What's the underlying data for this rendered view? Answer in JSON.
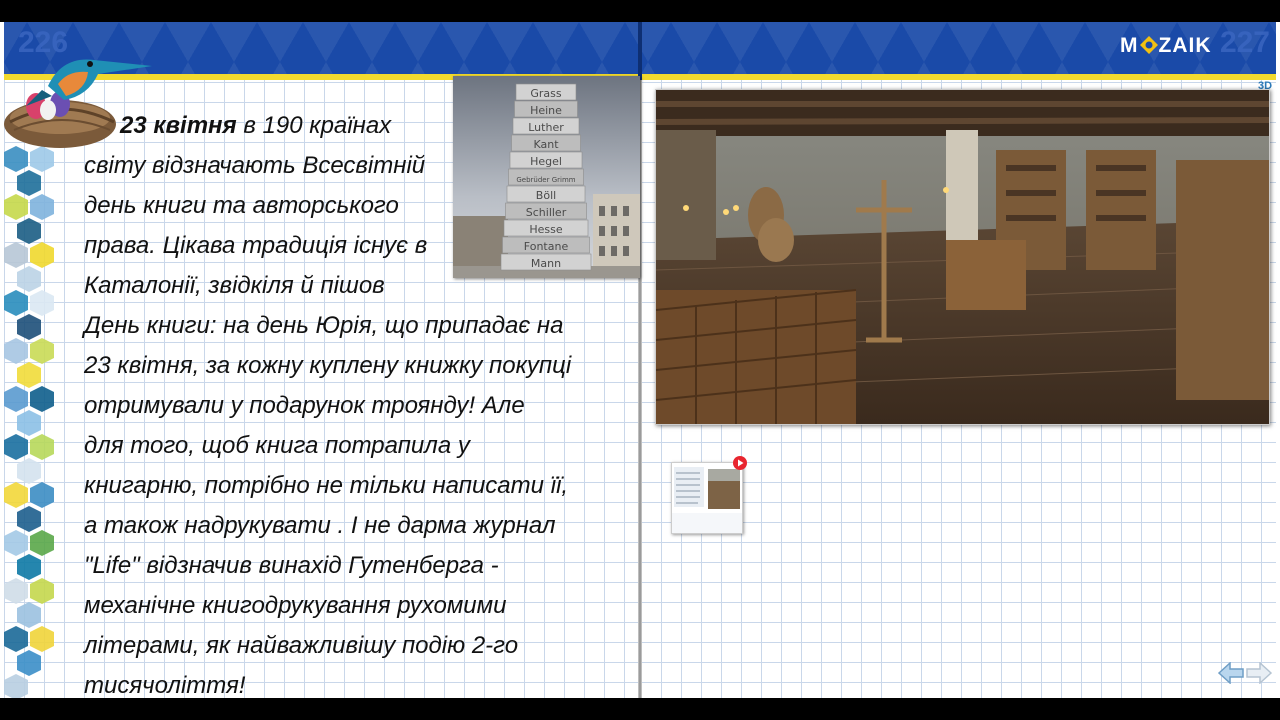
{
  "header": {
    "page_left": "226",
    "page_right": "227",
    "logo_before": "M",
    "logo_after": "ZAIK",
    "badge": "3D"
  },
  "article": {
    "lines": [
      {
        "bold": "23 квітня",
        "text": " в 190 країнах"
      },
      {
        "text": "світу відзначають Всесвітній"
      },
      {
        "text": " день книги та авторського"
      },
      {
        "text": "права. Цікава традиція існує в"
      },
      {
        "text": " Каталонії, звідкіля й пішов"
      },
      {
        "text": "День книги: на день Юрія, що припадає на"
      },
      {
        "text": "23 квітня, за кожну куплену книжку покупці"
      },
      {
        "text": "отримували у подарунок троянду!  Але"
      },
      {
        "text": "для того, щоб книга потрапила у"
      },
      {
        "text": "книгарню, потрібно не тільки написати її,"
      },
      {
        "text": "а також  надрукувати . І не дарма журнал"
      },
      {
        "text": "\"Life\" відзначив винахід Гутенберга -"
      },
      {
        "text": "механічне книгодрукування рухомими"
      },
      {
        "text": "літерами, як найважливішу подію 2-го"
      },
      {
        "text": "тисячоліття!"
      }
    ]
  },
  "book_stack": {
    "spines": [
      "Grass",
      "Heine",
      "Luther",
      "Kant",
      "Hegel",
      "Gebrüder Grimm",
      "Böll",
      "Schiller",
      "Hesse",
      "Fontane",
      "Mann"
    ]
  },
  "colors": {
    "banner": "#1a4aa8",
    "banner_stripe": "#f2da2e",
    "grid": "#c9d7ea",
    "logo_accent": "#f2c011",
    "play_button": "#e8252f"
  },
  "icons": {
    "kingfisher": "kingfisher-nest-icon",
    "play": "play-icon",
    "prev": "arrow-left-icon",
    "next": "arrow-right-icon"
  }
}
